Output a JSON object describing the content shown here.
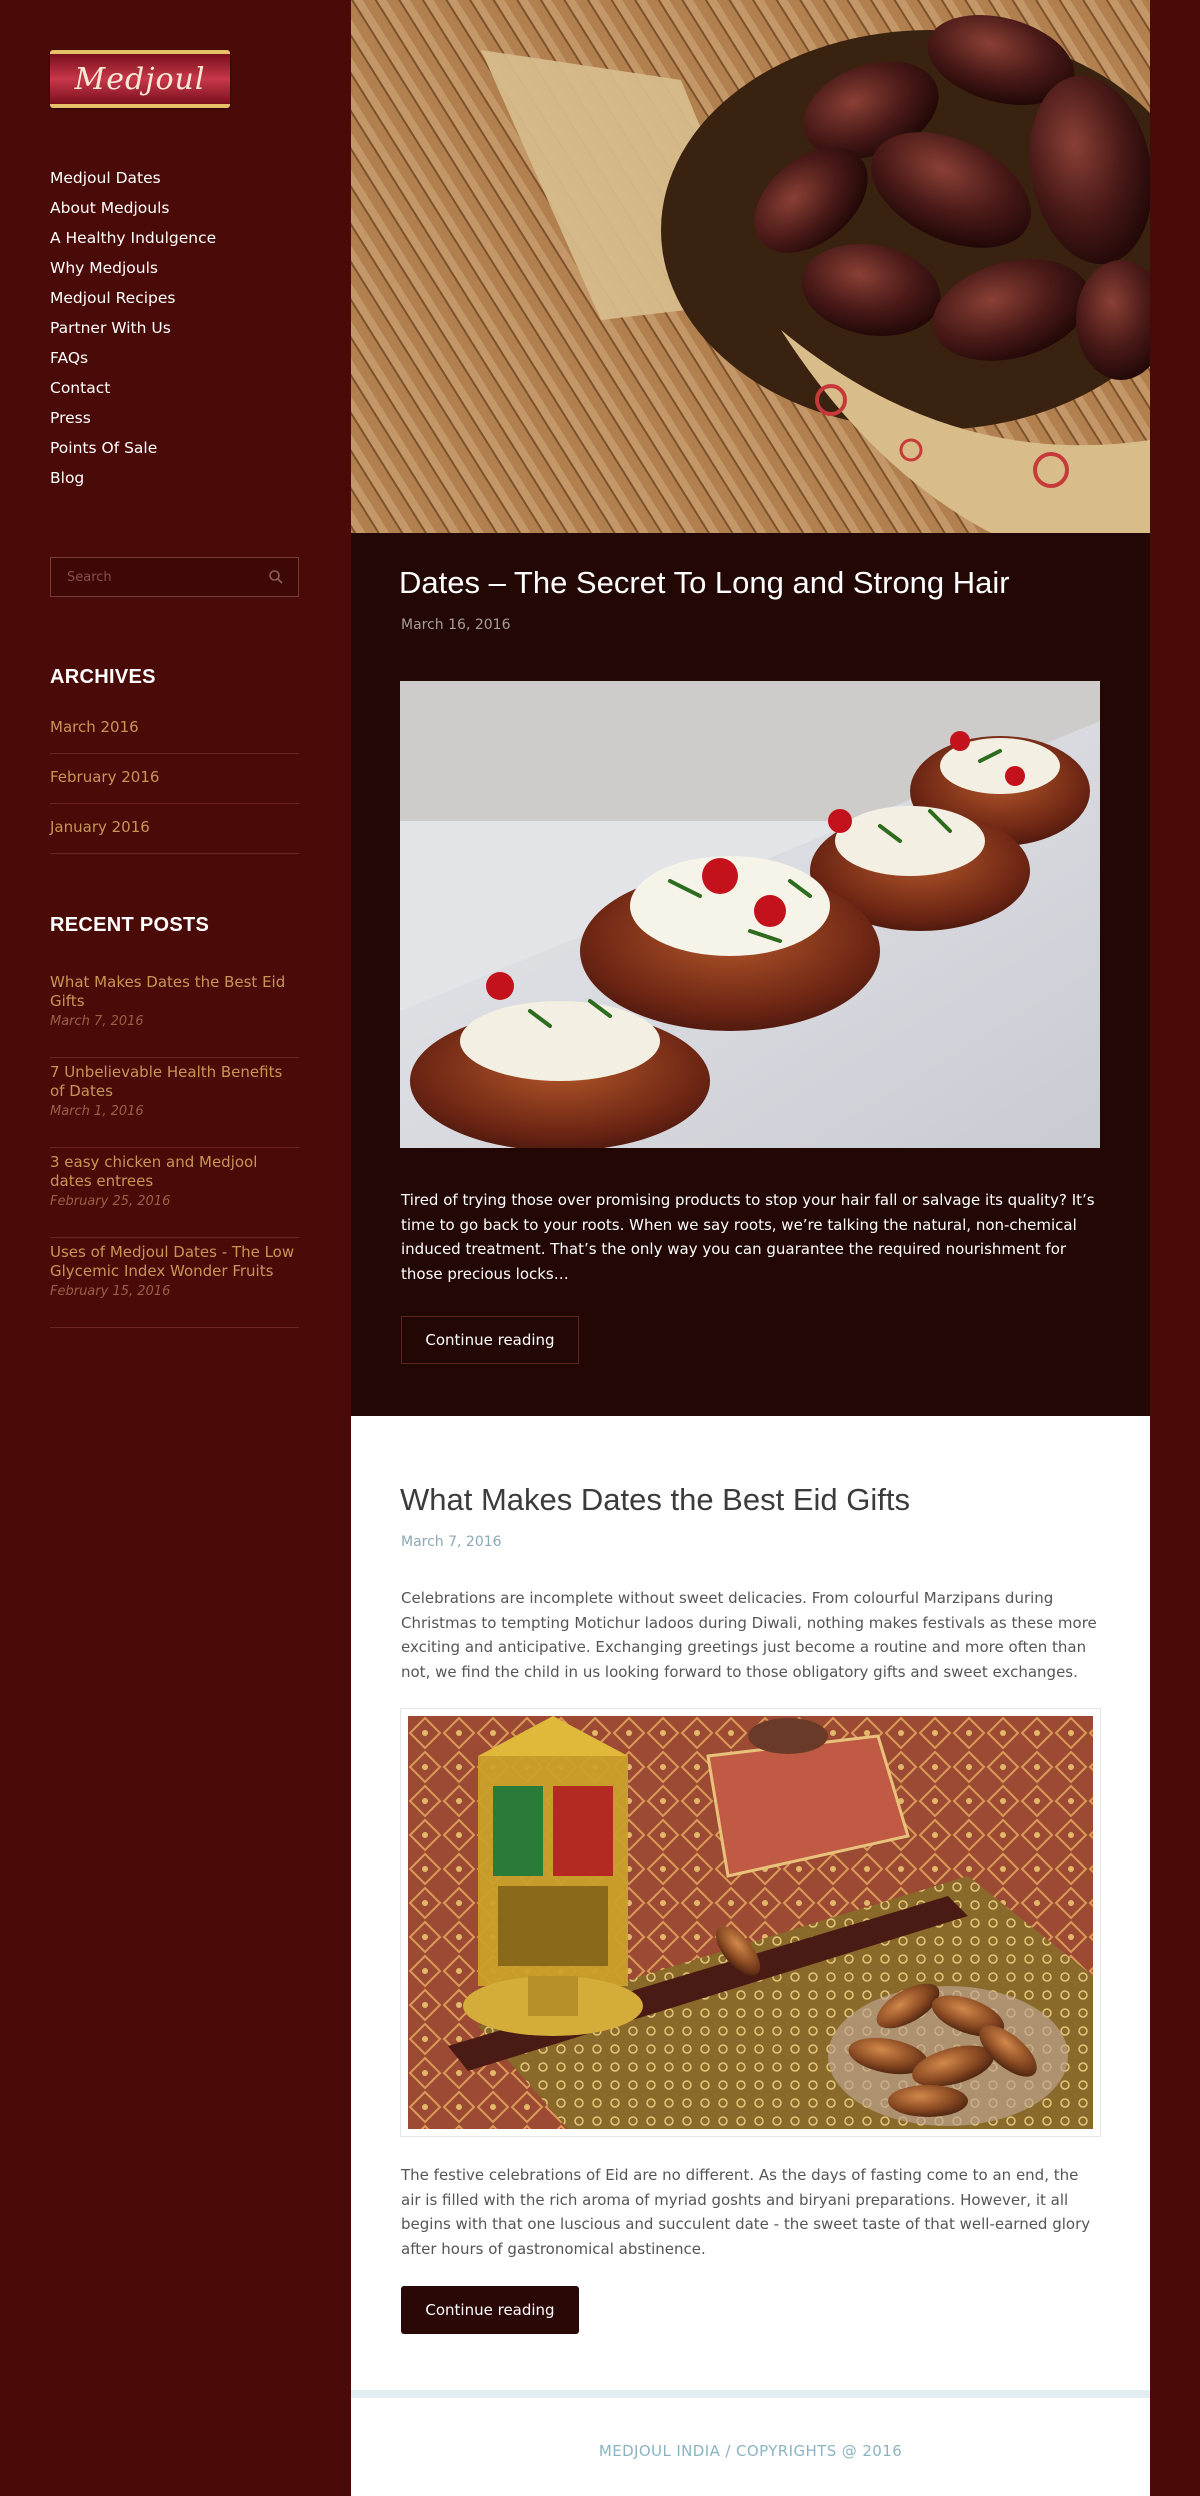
{
  "brand": {
    "logo_text": "Medjoul"
  },
  "nav": {
    "items": [
      "Medjoul Dates",
      "About Medjouls",
      "A Healthy Indulgence",
      "Why Medjouls",
      "Medjoul Recipes",
      "Partner With Us",
      "FAQs",
      "Contact",
      "Press",
      "Points Of Sale",
      "Blog"
    ]
  },
  "search": {
    "placeholder": "Search",
    "icon": "search-icon"
  },
  "archives": {
    "title": "ARCHIVES",
    "items": [
      "March 2016",
      "February 2016",
      "January 2016"
    ]
  },
  "recent_posts": {
    "title": "RECENT POSTS",
    "items": [
      {
        "title": "What Makes Dates the Best Eid Gifts",
        "date": "March 7, 2016"
      },
      {
        "title": "7 Unbelievable Health Benefits of Dates",
        "date": "March 1, 2016"
      },
      {
        "title": "3 easy chicken and Medjool dates entrees",
        "date": "February 25, 2016"
      },
      {
        "title": "Uses of Medjoul Dates - The Low Glycemic Index Wonder Fruits",
        "date": "February 15, 2016"
      }
    ]
  },
  "posts": [
    {
      "title": "Dates – The Secret To Long and Strong Hair",
      "date": "March 16, 2016",
      "excerpt": "Tired of trying those over promising products to stop your hair fall or salvage its quality? It’s time to go back to your roots. When we say roots, we’re talking the natural, non-chemical induced treatment. That’s the only way you can guarantee the required nourishment for those precious locks…",
      "button": "Continue reading"
    },
    {
      "title": "What Makes Dates the Best Eid Gifts",
      "date": "March 7, 2016",
      "excerpt_1": "Celebrations are incomplete without sweet delicacies. From colourful Marzipans during Christmas to tempting Motichur ladoos during Diwali, nothing makes festivals as these more exciting and anticipative. Exchanging greetings just become a routine and more often than not, we find the child in us looking forward to those obligatory gifts and sweet exchanges.",
      "excerpt_2": "The festive celebrations of Eid are no different. As the days of fasting come to an end, the air is filled with the rich aroma of myriad goshts and biryani preparations. However, it all begins with that one luscious and succulent date - the sweet taste of that well-earned glory after hours of gastronomical abstinence.",
      "button": "Continue reading"
    }
  ],
  "footer": {
    "text": "MEDJOUL INDIA / COPYRIGHTS @ 2016"
  },
  "colors": {
    "sidebar_bg": "#4a0a08",
    "dark_post_bg": "#220705",
    "link_gold": "#c69655",
    "footer_text": "#8ab4c2"
  }
}
